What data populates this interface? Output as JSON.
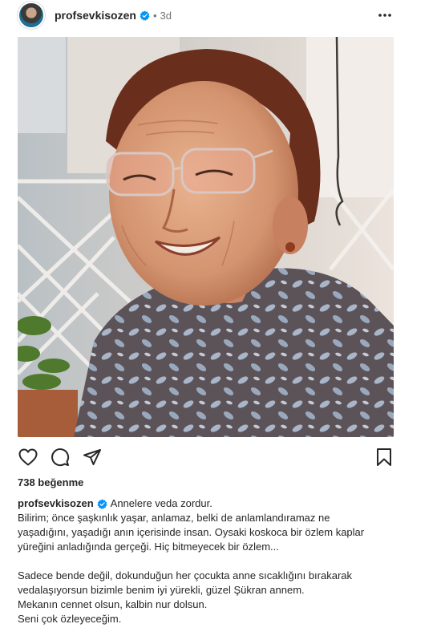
{
  "post": {
    "username": "profsevkisozen",
    "separator": "•",
    "time_ago": "3d",
    "likes_text": "738 beğenme",
    "caption_title": "Annelere veda zordur.",
    "caption_para1": "Bilirim; önce şaşkınlık yaşar, anlamaz, belki de anlamlandıramaz ne\nyaşadığını, yaşadığı anın içerisinde insan. Oysaki koskoca bir özlem kaplar\nyüreğini anladığında gerçeği. Hiç bitmeyecek bir özlem...",
    "caption_para2": "Sadece bende değil, dokunduğun her çocukta anne sıcaklığını bırakarak\nvedalaşıyorsun bizimle benim iyi yürekli, güzel Şükran annem.\nMekanın cennet olsun, kalbin nur dolsun.\nSeni çok özleyeceğim."
  },
  "icons": {
    "verified": "verified-badge-icon",
    "more": "more-options-icon",
    "like": "heart-icon",
    "comment": "comment-bubble-icon",
    "share": "paper-plane-icon",
    "save": "bookmark-icon"
  },
  "colors": {
    "verified_blue": "#0095f6",
    "text": "#262626",
    "muted": "#737373"
  }
}
